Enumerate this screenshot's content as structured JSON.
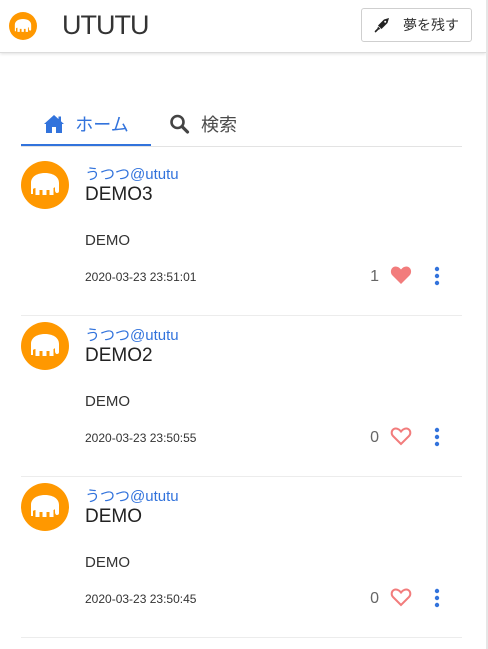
{
  "header": {
    "logo_text": "UTUTU",
    "dream_button_label": "夢を残す"
  },
  "tabs": [
    {
      "label": "ホーム",
      "active": true
    },
    {
      "label": "検索",
      "active": false
    }
  ],
  "posts": [
    {
      "user": "うつつ@ututu",
      "title": "DEMO3",
      "body": "DEMO",
      "time": "2020-03-23 23:51:01",
      "likes": "1",
      "liked": true
    },
    {
      "user": "うつつ@ututu",
      "title": "DEMO2",
      "body": "DEMO",
      "time": "2020-03-23 23:50:55",
      "likes": "0",
      "liked": false
    },
    {
      "user": "うつつ@ututu",
      "title": "DEMO",
      "body": "DEMO",
      "time": "2020-03-23 23:50:45",
      "likes": "0",
      "liked": false
    }
  ],
  "colors": {
    "accent": "#3273dc",
    "brand_orange": "#ff9800",
    "heart": "#f27c7c"
  }
}
